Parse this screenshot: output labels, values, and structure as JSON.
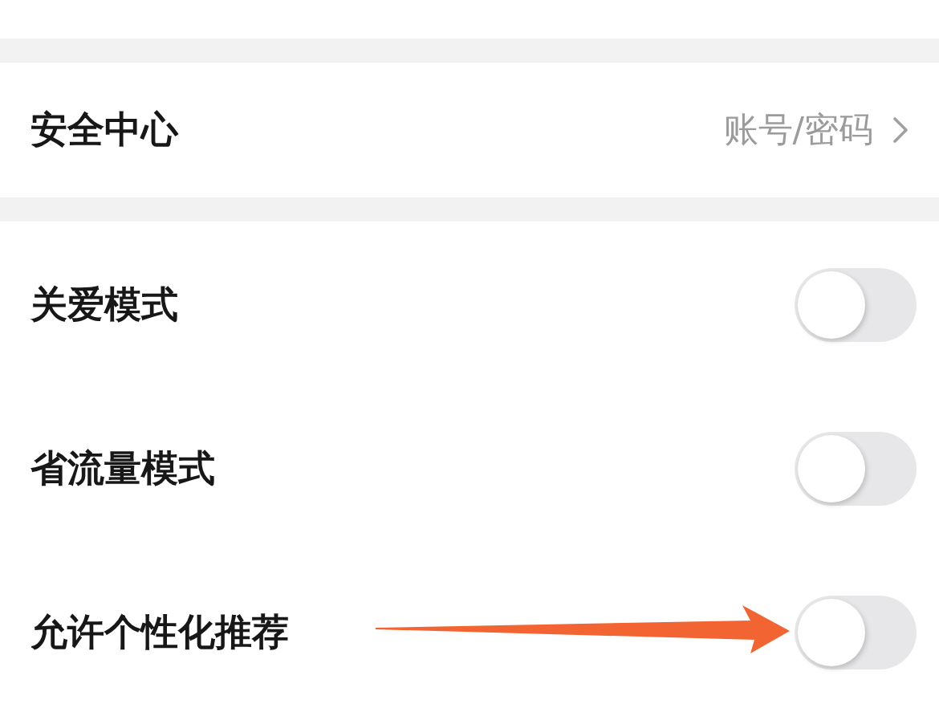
{
  "security": {
    "label": "安全中心",
    "value": "账号/密码"
  },
  "toggles": [
    {
      "label": "关爱模式",
      "on": false,
      "arrow_marked": false
    },
    {
      "label": "省流量模式",
      "on": false,
      "arrow_marked": false
    },
    {
      "label": "允许个性化推荐",
      "on": false,
      "arrow_marked": true
    }
  ]
}
